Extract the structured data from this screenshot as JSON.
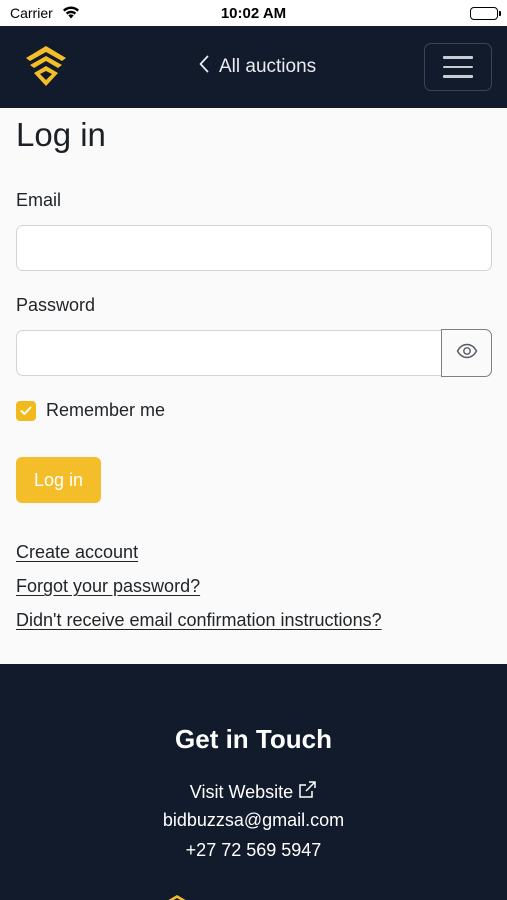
{
  "status_bar": {
    "carrier": "Carrier",
    "time": "10:02 AM"
  },
  "navbar": {
    "logo_icon": "bidbuzz-logo-icon",
    "back_label": "All auctions",
    "menu_icon": "hamburger-icon"
  },
  "page": {
    "title": "Log in"
  },
  "form": {
    "email_label": "Email",
    "email_value": "",
    "password_label": "Password",
    "password_value": "",
    "remember_label": "Remember me",
    "remember_checked": true,
    "submit_label": "Log in"
  },
  "links": {
    "create_account": "Create account",
    "forgot_password": "Forgot your password?",
    "no_confirmation": "Didn't receive email confirmation instructions?"
  },
  "footer": {
    "title": "Get in Touch",
    "visit_website": "Visit Website",
    "email": "bidbuzzsa@gmail.com",
    "phone": "+27 72 569 5947"
  },
  "colors": {
    "brand_dark": "#121b2b",
    "accent": "#f4be2a"
  }
}
